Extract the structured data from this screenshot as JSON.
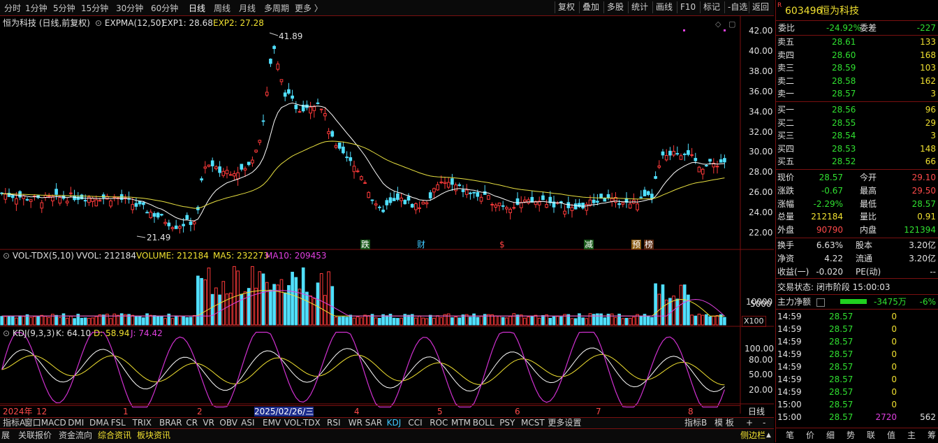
{
  "toolbar": {
    "periods": [
      "分时",
      "1分钟",
      "5分钟",
      "15分钟",
      "30分钟",
      "60分钟",
      "日线",
      "周线",
      "月线",
      "多周期",
      "更多 〉"
    ],
    "active_period": "日线",
    "tools": [
      "复权",
      "叠加",
      "多股",
      "统计",
      "画线",
      "F10",
      "标记",
      "-自选",
      "返回"
    ]
  },
  "main_chart": {
    "title": "恒为科技 (日线,前复权)",
    "indicator": "EXPMA(12,50)",
    "exp1": "EXP1: 28.68",
    "exp2": "EXP2: 27.28",
    "high_label": "41.89",
    "low_label": "21.49",
    "y_ticks": [
      "42.00",
      "40.00",
      "38.00",
      "36.00",
      "34.00",
      "32.00",
      "30.00",
      "28.00",
      "26.00",
      "24.00",
      "22.00"
    ],
    "events": [
      "跌",
      "财",
      "$",
      "减",
      "预",
      "榜"
    ]
  },
  "vol_chart": {
    "indicator": "VOL-TDX(5,10)",
    "vvol": "VVOL: 212184",
    "volume": "VOLUME: 212184",
    "ma5": "MA5: 232273",
    "ma10": "MA10: 209453",
    "y_ticks": [
      "10000",
      "5000"
    ],
    "unit": "X100"
  },
  "kdj_chart": {
    "indicator": "KDJ(9,3,3)",
    "k": "K: 64.10",
    "d": "D: 58.94",
    "j": "J: 74.42",
    "y_ticks": [
      "100.00",
      "80.00",
      "50.00",
      "20.00"
    ]
  },
  "x_axis": {
    "labels": [
      "2024年",
      "12",
      "1",
      "2",
      "2025/02/26/三",
      "4",
      "5",
      "6",
      "7",
      "8"
    ],
    "period_label": "日线"
  },
  "indicator_tabs": [
    "指标A",
    "窗口",
    "MACD",
    "DMI",
    "DMA",
    "FSL",
    "TRIX",
    "BRAR",
    "CR",
    "VR",
    "OBV",
    "ASI",
    "EMV",
    "VOL-TDX",
    "RSI",
    "WR",
    "SAR",
    "KDJ",
    "CCI",
    "ROC",
    "MTM",
    "BOLL",
    "PSY",
    "MCST",
    "更多",
    "设置"
  ],
  "active_tab": "KDJ",
  "right_tabs": [
    "指标B",
    "模 板",
    "+",
    "-"
  ],
  "bottom_tabs": [
    "展",
    "关联报价",
    "资金流向",
    "综合资讯",
    "板块资讯"
  ],
  "bottom_right": [
    "侧边栏",
    "▲"
  ],
  "quote": {
    "badge": "R",
    "code": "603496",
    "name": "恒为科技",
    "webi_label": "委比",
    "webi": "-24.92%",
    "weicha_label": "委差",
    "weicha": "-227",
    "asks": [
      {
        "label": "卖五",
        "price": "28.61",
        "vol": "133"
      },
      {
        "label": "卖四",
        "price": "28.60",
        "vol": "168"
      },
      {
        "label": "卖三",
        "price": "28.59",
        "vol": "103"
      },
      {
        "label": "卖二",
        "price": "28.58",
        "vol": "162"
      },
      {
        "label": "卖一",
        "price": "28.57",
        "vol": "3"
      }
    ],
    "bids": [
      {
        "label": "买一",
        "price": "28.56",
        "vol": "96"
      },
      {
        "label": "买二",
        "price": "28.55",
        "vol": "29"
      },
      {
        "label": "买三",
        "price": "28.54",
        "vol": "3"
      },
      {
        "label": "买四",
        "price": "28.53",
        "vol": "148"
      },
      {
        "label": "买五",
        "price": "28.52",
        "vol": "66"
      }
    ],
    "stats": [
      {
        "l1": "现价",
        "v1": "28.57",
        "l2": "今开",
        "v2": "29.10"
      },
      {
        "l1": "涨跌",
        "v1": "-0.67",
        "l2": "最高",
        "v2": "29.50"
      },
      {
        "l1": "涨幅",
        "v1": "-2.29%",
        "l2": "最低",
        "v2": "28.57"
      },
      {
        "l1": "总量",
        "v1": "212184",
        "l2": "量比",
        "v2": "0.91"
      },
      {
        "l1": "外盘",
        "v1": "90790",
        "l2": "内盘",
        "v2": "121394"
      }
    ],
    "stats2": [
      {
        "l1": "换手",
        "v1": "6.63%",
        "l2": "股本",
        "v2": "3.20亿"
      },
      {
        "l1": "净资",
        "v1": "4.22",
        "l2": "流通",
        "v2": "3.20亿"
      },
      {
        "l1": "收益(一)",
        "v1": "-0.020",
        "l2": "PE(动)",
        "v2": "--"
      }
    ],
    "trade_state": "交易状态: 闭市阶段 15:00:03",
    "main_flow_label": "主力净额",
    "main_flow": "-3475万",
    "main_flow_pct": "-6%",
    "ticks": [
      {
        "t": "14:59",
        "p": "28.57",
        "v": "0",
        "f": ""
      },
      {
        "t": "14:59",
        "p": "28.57",
        "v": "0",
        "f": ""
      },
      {
        "t": "14:59",
        "p": "28.57",
        "v": "0",
        "f": ""
      },
      {
        "t": "14:59",
        "p": "28.57",
        "v": "0",
        "f": ""
      },
      {
        "t": "14:59",
        "p": "28.57",
        "v": "0",
        "f": ""
      },
      {
        "t": "14:59",
        "p": "28.57",
        "v": "0",
        "f": ""
      },
      {
        "t": "14:59",
        "p": "28.57",
        "v": "0",
        "f": ""
      },
      {
        "t": "15:00",
        "p": "28.57",
        "v": "0",
        "f": ""
      },
      {
        "t": "15:00",
        "p": "28.57",
        "v": "2720",
        "f": "562"
      }
    ],
    "footer_tabs": [
      "笔",
      "价",
      "细",
      "势",
      "联",
      "值",
      "主",
      "筹"
    ]
  }
}
